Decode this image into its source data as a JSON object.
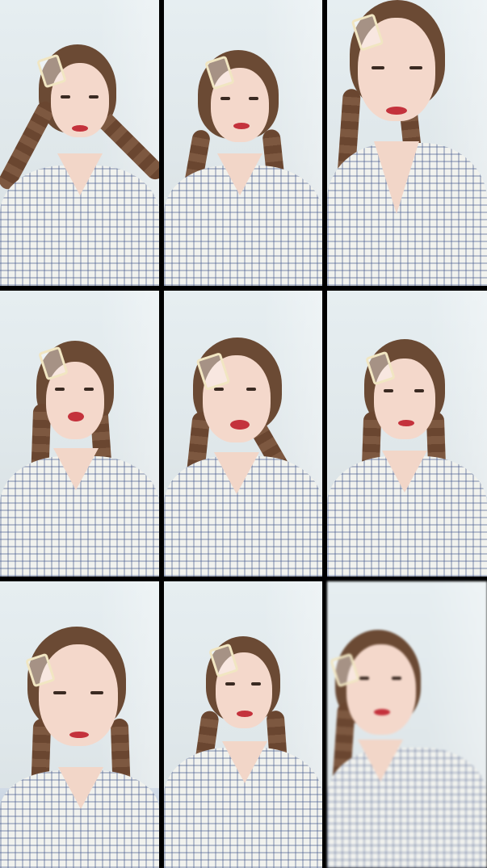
{
  "grid": {
    "rows": 3,
    "columns": 3,
    "tiles": [
      {
        "description_icon": "person-photo"
      },
      {
        "description_icon": "person-photo"
      },
      {
        "description_icon": "person-photo"
      },
      {
        "description_icon": "person-photo"
      },
      {
        "description_icon": "person-photo"
      },
      {
        "description_icon": "person-photo"
      },
      {
        "description_icon": "person-photo"
      },
      {
        "description_icon": "person-photo"
      },
      {
        "description_icon": "person-photo"
      }
    ]
  },
  "colors": {
    "background": "#000000",
    "wall": "#e2eaee",
    "hair": "#6b4a34",
    "lips": "#c4323c",
    "clip": "#f1e6c2",
    "dress_pattern": "#465a8c"
  }
}
